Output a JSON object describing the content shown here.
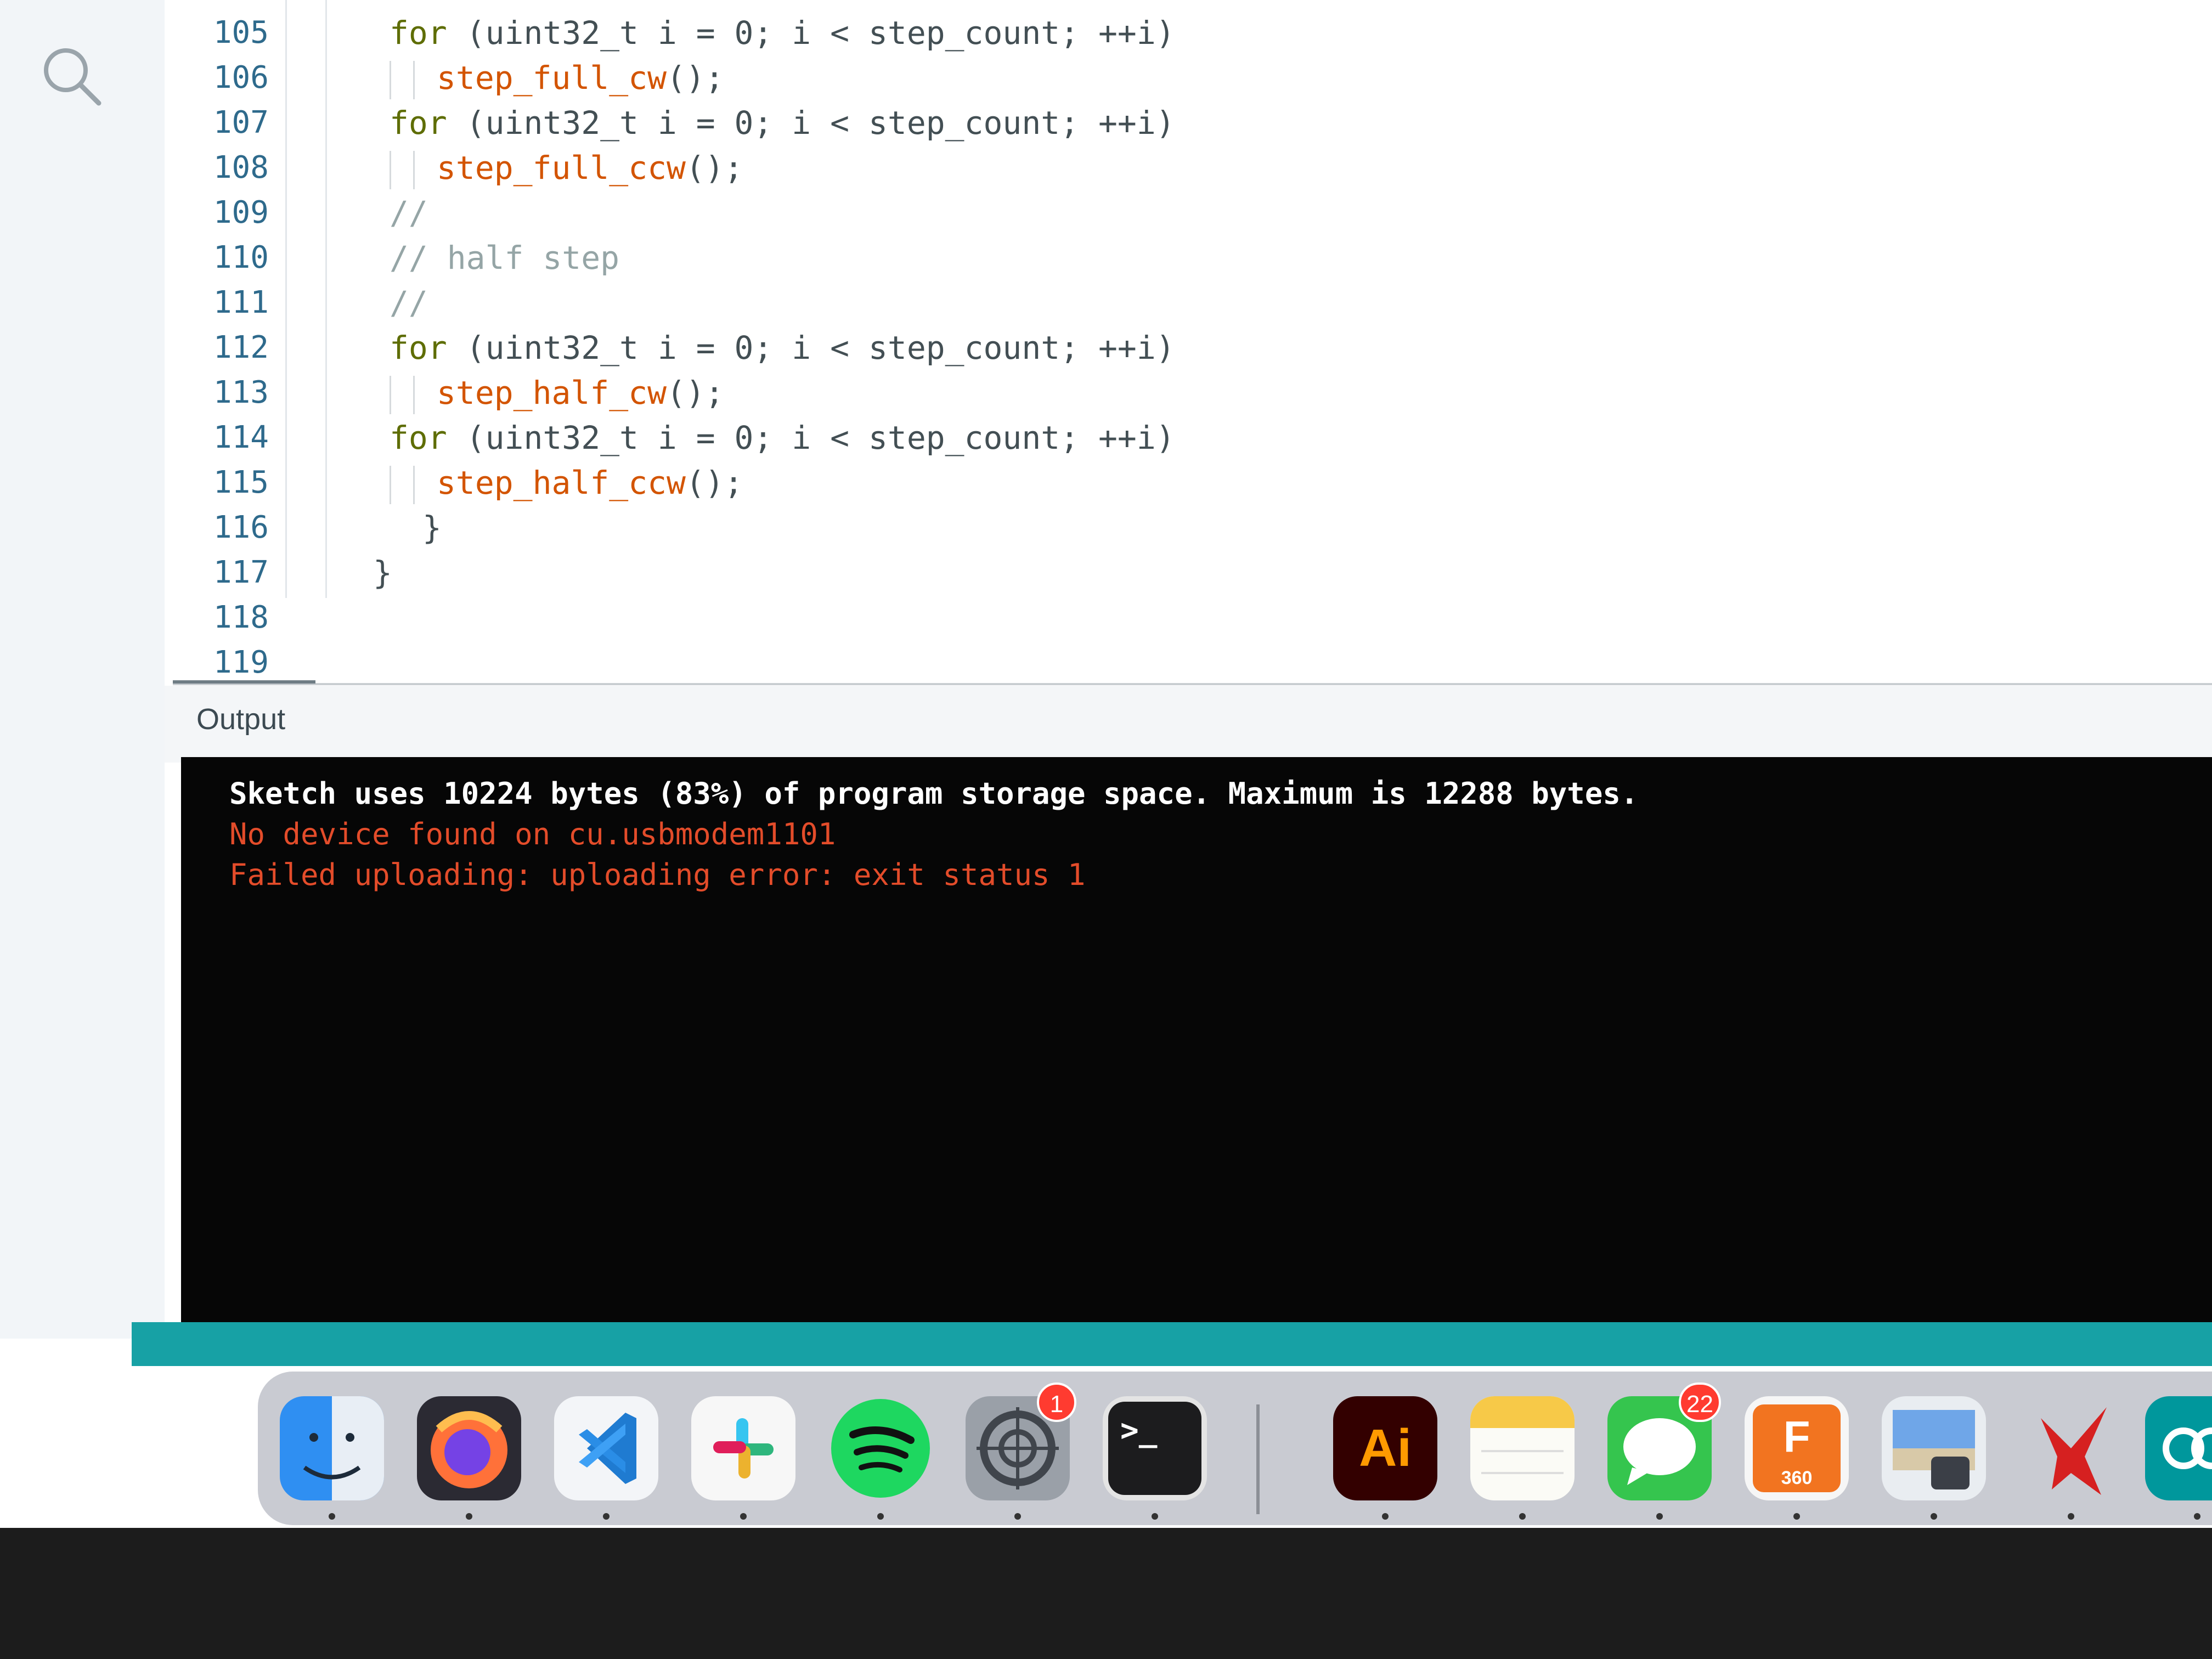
{
  "editor": {
    "lines": [
      {
        "num": "105",
        "parts": [
          {
            "t": "for",
            "c": "kw"
          },
          {
            "t": " (uint32_t i = 0; i < step_count; ++i)",
            "c": ""
          }
        ]
      },
      {
        "num": "106",
        "parts": [
          {
            "t": "step_full_cw",
            "c": "fn"
          },
          {
            "t": "();",
            "c": ""
          }
        ]
      },
      {
        "num": "107",
        "parts": [
          {
            "t": "for",
            "c": "kw"
          },
          {
            "t": " (uint32_t i = 0; i < step_count; ++i)",
            "c": ""
          }
        ]
      },
      {
        "num": "108",
        "parts": [
          {
            "t": "step_full_ccw",
            "c": "fn"
          },
          {
            "t": "();",
            "c": ""
          }
        ]
      },
      {
        "num": "109",
        "parts": [
          {
            "t": "//",
            "c": "cmt"
          }
        ]
      },
      {
        "num": "110",
        "parts": [
          {
            "t": "// half step",
            "c": "cmt"
          }
        ]
      },
      {
        "num": "111",
        "parts": [
          {
            "t": "//",
            "c": "cmt"
          }
        ]
      },
      {
        "num": "112",
        "parts": [
          {
            "t": "for",
            "c": "kw"
          },
          {
            "t": " (uint32_t i = 0; i < step_count; ++i)",
            "c": ""
          }
        ]
      },
      {
        "num": "113",
        "parts": [
          {
            "t": "step_half_cw",
            "c": "fn"
          },
          {
            "t": "();",
            "c": ""
          }
        ]
      },
      {
        "num": "114",
        "parts": [
          {
            "t": "for",
            "c": "kw"
          },
          {
            "t": " (uint32_t i = 0; i < step_count; ++i)",
            "c": ""
          }
        ]
      },
      {
        "num": "115",
        "parts": [
          {
            "t": "step_half_ccw",
            "c": "fn"
          },
          {
            "t": "();",
            "c": ""
          }
        ]
      },
      {
        "num": "116",
        "parts": [
          {
            "t": "}",
            "c": ""
          }
        ]
      },
      {
        "num": "117",
        "parts": [
          {
            "t": "}",
            "c": ""
          }
        ]
      },
      {
        "num": "118",
        "parts": []
      },
      {
        "num": "119",
        "parts": []
      }
    ]
  },
  "output": {
    "label": "Output",
    "lines": [
      {
        "text": "Sketch uses 10224 bytes (83%) of program storage space. Maximum is 12288 bytes.",
        "style": "white"
      },
      {
        "text": "No device found on cu.usbmodem1101",
        "style": "red"
      },
      {
        "text": "Failed uploading: uploading error: exit status 1",
        "style": "red"
      }
    ]
  },
  "dock": {
    "apps": [
      {
        "name": "finder",
        "icon": "finder-icon"
      },
      {
        "name": "firefox",
        "icon": "firefox-icon"
      },
      {
        "name": "vscode",
        "icon": "vscode-icon"
      },
      {
        "name": "slack",
        "icon": "slack-icon"
      },
      {
        "name": "spotify",
        "icon": "spotify-icon"
      },
      {
        "name": "system-settings",
        "icon": "settings-icon",
        "badge": "1"
      },
      {
        "name": "terminal",
        "icon": "terminal-icon",
        "label": ">_"
      },
      {
        "name": "illustrator",
        "icon": "illustrator-icon",
        "label": "Ai"
      },
      {
        "name": "notes",
        "icon": "notes-icon"
      },
      {
        "name": "messages",
        "icon": "messages-icon",
        "badge": "22"
      },
      {
        "name": "fusion360",
        "icon": "fusion360-icon",
        "label": "F",
        "sublabel": "360"
      },
      {
        "name": "preview",
        "icon": "preview-icon"
      },
      {
        "name": "app-bird",
        "icon": "bird-icon"
      },
      {
        "name": "arduino",
        "icon": "arduino-icon"
      }
    ]
  },
  "colors": {
    "keyword": "#5e6d03",
    "function": "#d35400",
    "comment": "#95a5a6",
    "console_error": "#e34c2a",
    "status_bar": "#17a1a5"
  }
}
